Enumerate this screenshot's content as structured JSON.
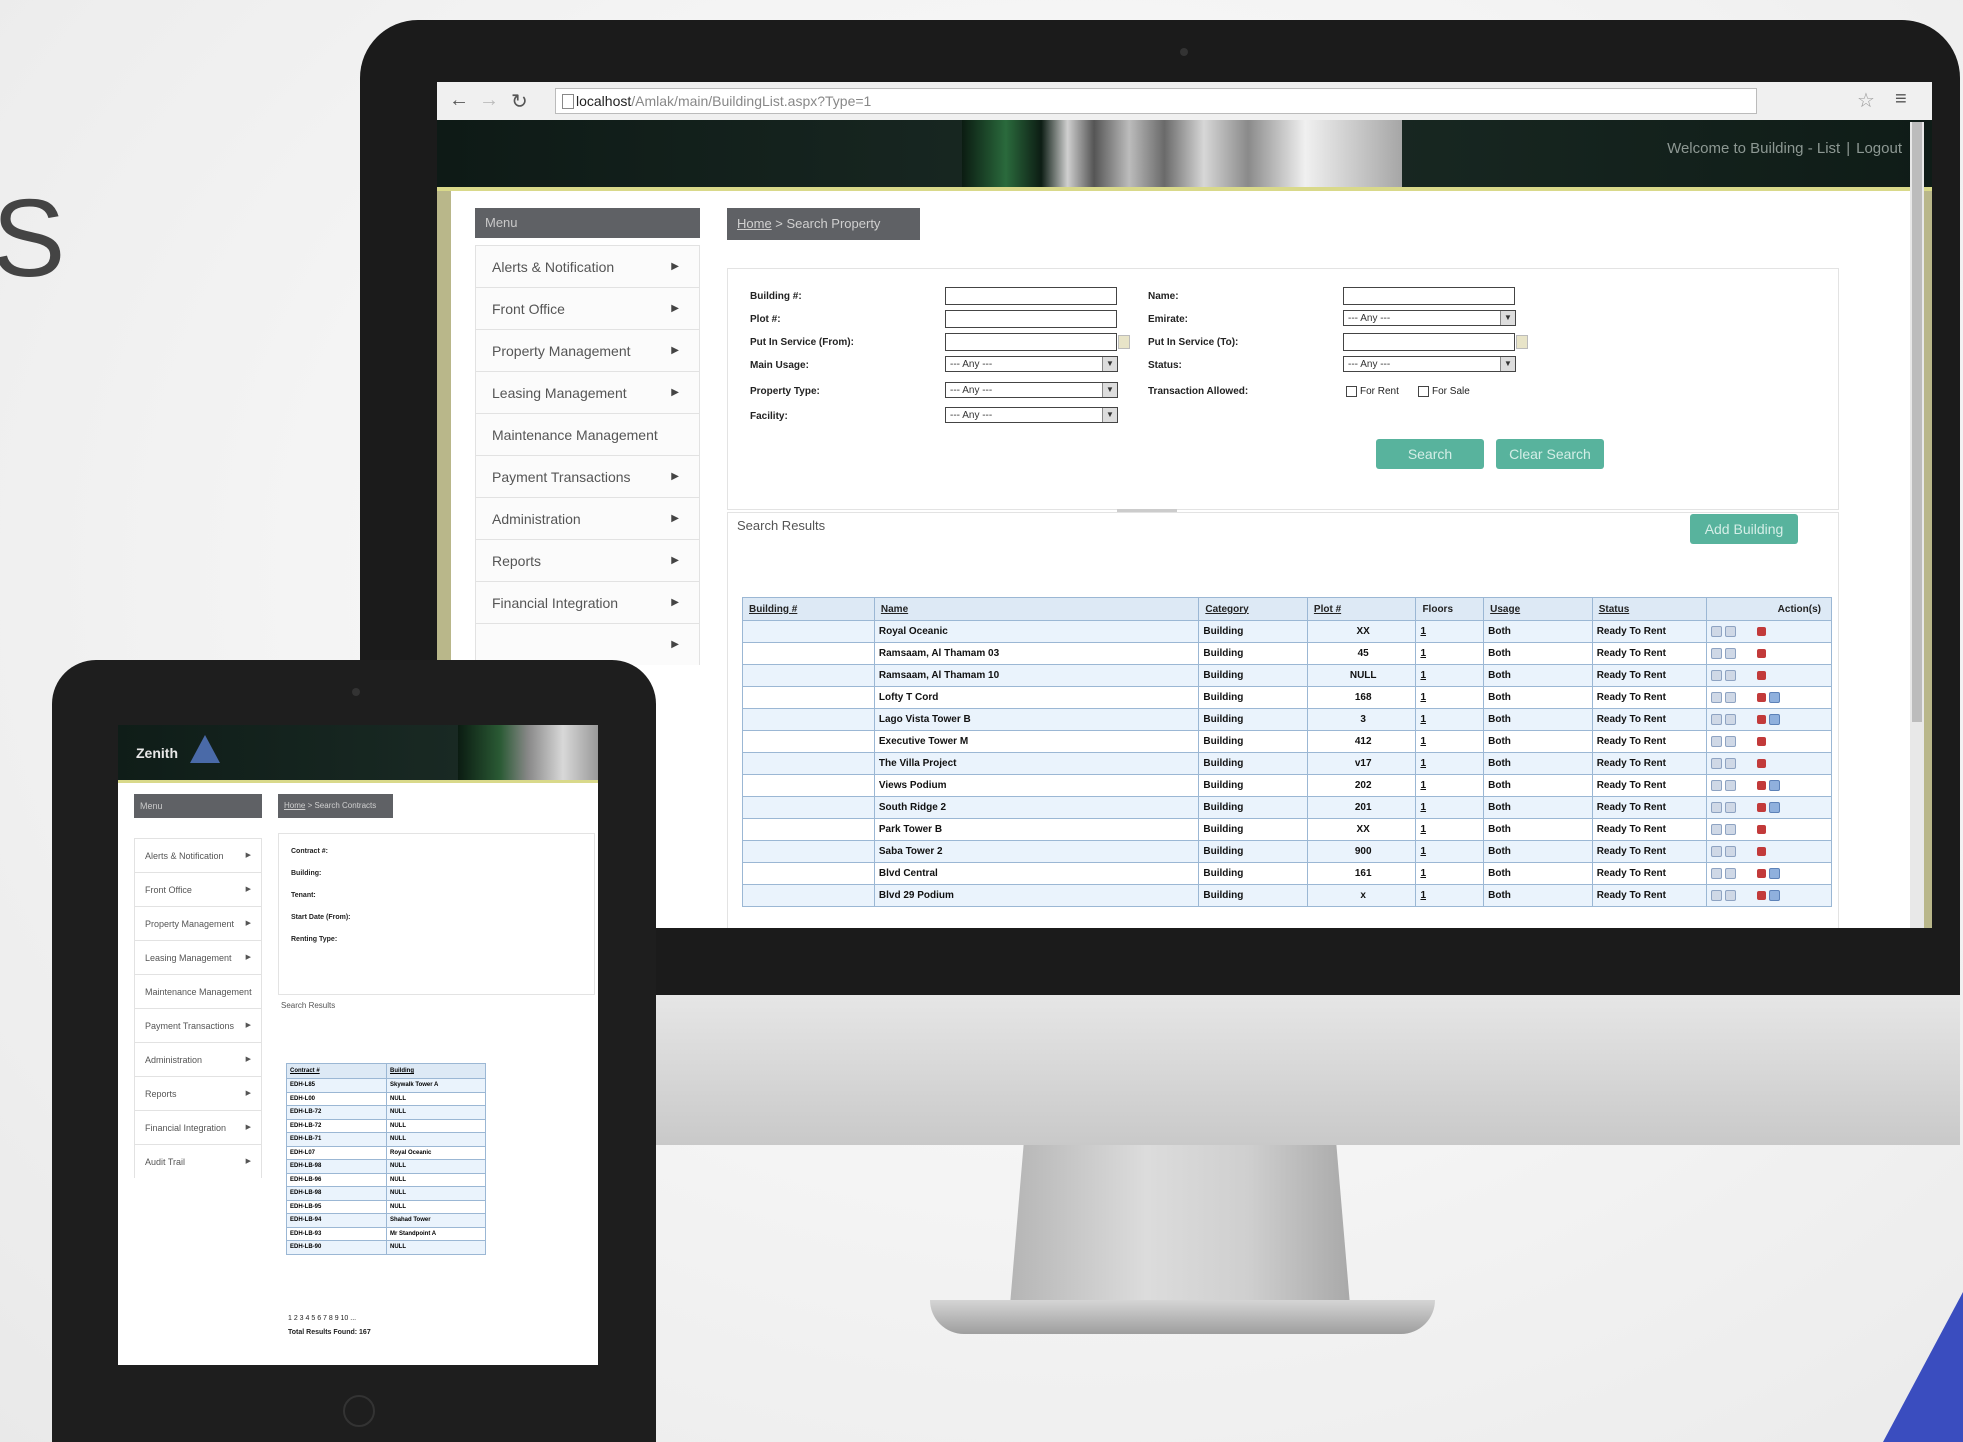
{
  "browser": {
    "url_host": "localhost",
    "url_path": "/Amlak/main/BuildingList.aspx?Type=1"
  },
  "header": {
    "welcome": "Welcome to Building - List",
    "logout": "Logout"
  },
  "sidebar": {
    "title": "Menu",
    "items": [
      {
        "label": "Alerts & Notification"
      },
      {
        "label": "Front Office"
      },
      {
        "label": "Property Management"
      },
      {
        "label": "Leasing Management"
      },
      {
        "label": "Maintenance Management"
      },
      {
        "label": "Payment Transactions"
      },
      {
        "label": "Administration"
      },
      {
        "label": "Reports"
      },
      {
        "label": "Financial Integration"
      },
      {
        "label": ""
      }
    ]
  },
  "breadcrumb": {
    "home": "Home",
    "current": " > Search Property"
  },
  "search": {
    "building_label": "Building #:",
    "plot_label": "Plot #:",
    "put_in_service_from_label": "Put In Service (From):",
    "main_usage_label": "Main Usage:",
    "property_type_label": "Property Type:",
    "facility_label": "Facility:",
    "name_label": "Name:",
    "emirate_label": "Emirate:",
    "put_in_service_to_label": "Put In Service (To):",
    "status_label": "Status:",
    "transaction_allowed_label": "Transaction Allowed:",
    "any_option": "--- Any ---",
    "for_rent_label": "For Rent",
    "for_sale_label": "For Sale",
    "search_button": "Search",
    "clear_button": "Clear Search"
  },
  "results": {
    "label": "Search Results",
    "add_button": "Add Building",
    "columns": [
      "Building #",
      "Name",
      "Category",
      "Plot #",
      "Floors",
      "Usage",
      "Status",
      "Action(s)"
    ],
    "rows": [
      {
        "name": "Royal Oceanic",
        "category": "Building",
        "plot": "XX",
        "floors": "1",
        "usage": "Both",
        "status": "Ready To Rent",
        "check": false
      },
      {
        "name": "Ramsaam, Al Thamam 03",
        "category": "Building",
        "plot": "45",
        "floors": "1",
        "usage": "Both",
        "status": "Ready To Rent",
        "check": false
      },
      {
        "name": "Ramsaam, Al Thamam 10",
        "category": "Building",
        "plot": "NULL",
        "floors": "1",
        "usage": "Both",
        "status": "Ready To Rent",
        "check": false
      },
      {
        "name": "Lofty T Cord",
        "category": "Building",
        "plot": "168",
        "floors": "1",
        "usage": "Both",
        "status": "Ready To Rent",
        "check": true
      },
      {
        "name": "Lago Vista Tower B",
        "category": "Building",
        "plot": "3",
        "floors": "1",
        "usage": "Both",
        "status": "Ready To Rent",
        "check": true
      },
      {
        "name": "Executive Tower M",
        "category": "Building",
        "plot": "412",
        "floors": "1",
        "usage": "Both",
        "status": "Ready To Rent",
        "check": false
      },
      {
        "name": "The Villa Project",
        "category": "Building",
        "plot": "v17",
        "floors": "1",
        "usage": "Both",
        "status": "Ready To Rent",
        "check": false
      },
      {
        "name": "Views Podium",
        "category": "Building",
        "plot": "202",
        "floors": "1",
        "usage": "Both",
        "status": "Ready To Rent",
        "check": true
      },
      {
        "name": "South Ridge 2",
        "category": "Building",
        "plot": "201",
        "floors": "1",
        "usage": "Both",
        "status": "Ready To Rent",
        "check": true
      },
      {
        "name": "Park Tower B",
        "category": "Building",
        "plot": "XX",
        "floors": "1",
        "usage": "Both",
        "status": "Ready To Rent",
        "check": false
      },
      {
        "name": "Saba Tower 2",
        "category": "Building",
        "plot": "900",
        "floors": "1",
        "usage": "Both",
        "status": "Ready To Rent",
        "check": false
      },
      {
        "name": "Blvd Central",
        "category": "Building",
        "plot": "161",
        "floors": "1",
        "usage": "Both",
        "status": "Ready To Rent",
        "check": true
      },
      {
        "name": "Blvd 29 Podium",
        "category": "Building",
        "plot": "x",
        "floors": "1",
        "usage": "Both",
        "status": "Ready To Rent",
        "check": true
      }
    ]
  },
  "tablet": {
    "logo": "Zenith",
    "sidebar_title": "Menu",
    "breadcrumb_home": "Home",
    "breadcrumb_current": " > Search Contracts",
    "sidebar_items": [
      {
        "label": "Alerts & Notification"
      },
      {
        "label": "Front Office"
      },
      {
        "label": "Property Management"
      },
      {
        "label": "Leasing Management"
      },
      {
        "label": "Maintenance Management"
      },
      {
        "label": "Payment Transactions"
      },
      {
        "label": "Administration"
      },
      {
        "label": "Reports"
      },
      {
        "label": "Financial Integration"
      },
      {
        "label": "Audit Trail"
      }
    ],
    "form_labels": [
      "Contract #:",
      "Building:",
      "Tenant:",
      "Start Date (From):",
      "Renting Type:"
    ],
    "results_label": "Search Results",
    "columns": [
      "Contract #",
      "Building"
    ],
    "rows": [
      [
        "EDH-L85",
        "Skywalk Tower A"
      ],
      [
        "EDH-L00",
        "NULL"
      ],
      [
        "EDH-LB-72",
        "NULL"
      ],
      [
        "EDH-LB-72",
        "NULL"
      ],
      [
        "EDH-LB-71",
        "NULL"
      ],
      [
        "EDH-L07",
        "Royal Oceanic"
      ],
      [
        "EDH-LB-98",
        "NULL"
      ],
      [
        "EDH-LB-96",
        "NULL"
      ],
      [
        "EDH-LB-98",
        "NULL"
      ],
      [
        "EDH-LB-95",
        "NULL"
      ],
      [
        "EDH-LB-94",
        "Shahad Tower"
      ],
      [
        "EDH-LB-93",
        "Mr Standpoint A"
      ],
      [
        "EDH-LB-90",
        "NULL"
      ]
    ],
    "pager": "1 2 3 4 5 6 7 8 9 10 ...",
    "total": "Total Results Found: 167"
  }
}
